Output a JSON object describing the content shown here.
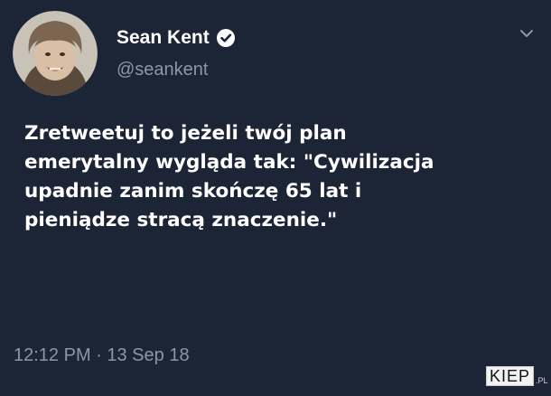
{
  "tweet": {
    "author": {
      "display_name": "Sean Kent",
      "handle": "@seankent",
      "verified_icon": "verified-badge-icon"
    },
    "text": "Zretweetuj to jeżeli twój plan\nemerytalny wygląda tak: \"Cywilizacja\nupadnie zanim skończę 65 lat i\npieniądze stracą znaczenie.\"",
    "timestamp": "12:12 PM · 13 Sep 18",
    "menu_icon": "chevron-down-icon"
  },
  "watermark": {
    "brand": "KIEP",
    "suffix": ".PL"
  },
  "colors": {
    "background": "#1c2536",
    "text_primary": "#ffffff",
    "text_secondary": "#8899a6"
  }
}
